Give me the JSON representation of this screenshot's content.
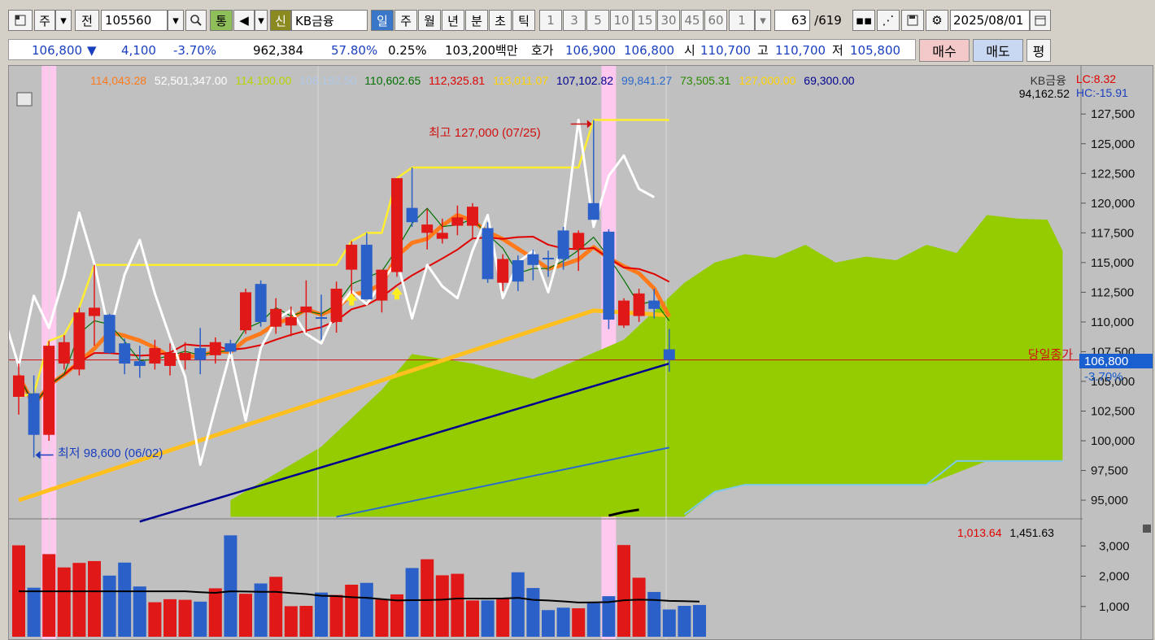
{
  "toolbar": {
    "market": "주",
    "jeon": "전",
    "code": "105560",
    "tong": "통",
    "sin": "신",
    "name": "KB금융",
    "periods": [
      "일",
      "주",
      "월",
      "년",
      "분",
      "초",
      "틱"
    ],
    "active_period": "일",
    "minutes": [
      "1",
      "3",
      "5",
      "10",
      "15",
      "30",
      "45",
      "60"
    ],
    "count_value": "1",
    "page_current": "63",
    "page_total": "/619",
    "date": "2025/08/01"
  },
  "quote": {
    "price": "106,800",
    "change": "4,100",
    "change_pct": "-3.70%",
    "volume": "962,384",
    "ratio": "57.80%",
    "turnover": "0.25%",
    "amount": "103,200백만",
    "hoga_label": "호가",
    "ask": "106,900",
    "bid": "106,800",
    "open_label": "시",
    "open": "110,700",
    "high_label": "고",
    "high": "110,700",
    "low_label": "저",
    "low": "105,800",
    "buy_label": "매수",
    "sell_label": "매도",
    "extra_label": "평"
  },
  "legend": {
    "items": [
      {
        "text": "114,043.28",
        "color": "#ff7a1a"
      },
      {
        "text": "52,501,347.00",
        "color": "#ffffff"
      },
      {
        "text": "114,100.00",
        "color": "#b8d400"
      },
      {
        "text": "108,192.50",
        "color": "#b0c8e8"
      },
      {
        "text": "110,602.65",
        "color": "#007000"
      },
      {
        "text": "112,325.81",
        "color": "#e00000"
      },
      {
        "text": "113,011.07",
        "color": "#ffd400"
      },
      {
        "text": "107,102.82",
        "color": "#000090"
      },
      {
        "text": "99,841.27",
        "color": "#2a6acc"
      },
      {
        "text": "73,505.31",
        "color": "#2a8a00"
      },
      {
        "text": "127,000.00",
        "color": "#ffd400"
      },
      {
        "text": "69,300.00",
        "color": "#000090"
      }
    ],
    "stock": "KB금융",
    "stock_value": "94,162.52",
    "lc": "LC:8.32",
    "hc": "HC:-15.91",
    "vol_items": [
      {
        "text": "1,013.64",
        "color": "#e00000"
      },
      {
        "text": "1,451.63",
        "color": "#000000"
      }
    ]
  },
  "annotations": {
    "high": "최고 127,000 (07/25)",
    "low": "최저 98,600 (06/02)",
    "close_line": "당일종가",
    "close_price": "106,800",
    "close_pct": "-3.70%"
  },
  "colors": {
    "up": "#e01818",
    "down": "#2a60c8",
    "bg": "#c0c0c0"
  },
  "chart_data": {
    "type": "candlestick",
    "price_ticks": [
      "127,500",
      "125,000",
      "122,500",
      "120,000",
      "117,500",
      "115,000",
      "112,500",
      "110,000",
      "107,500",
      "105,000",
      "102,500",
      "100,000",
      "97,500",
      "95,000"
    ],
    "volume_ticks": [
      "3,000",
      "2,000",
      "1,000"
    ],
    "ylim": [
      93500,
      129500
    ],
    "volume_ylim": [
      0,
      3600
    ],
    "candles": [
      {
        "o": 103700,
        "h": 106500,
        "l": 102200,
        "c": 105500
      },
      {
        "o": 104000,
        "h": 105500,
        "l": 98600,
        "c": 100500
      },
      {
        "o": 100500,
        "h": 108400,
        "l": 100000,
        "c": 108000
      },
      {
        "o": 106500,
        "h": 108900,
        "l": 106000,
        "c": 108300
      },
      {
        "o": 106000,
        "h": 111200,
        "l": 105500,
        "c": 110800
      },
      {
        "o": 110500,
        "h": 114800,
        "l": 108000,
        "c": 111200
      },
      {
        "o": 110600,
        "h": 110700,
        "l": 107300,
        "c": 107400
      },
      {
        "o": 108200,
        "h": 108600,
        "l": 105600,
        "c": 106500
      },
      {
        "o": 106700,
        "h": 108000,
        "l": 105300,
        "c": 106300
      },
      {
        "o": 106500,
        "h": 108500,
        "l": 106000,
        "c": 107800
      },
      {
        "o": 106300,
        "h": 108200,
        "l": 105500,
        "c": 107400
      },
      {
        "o": 106800,
        "h": 108300,
        "l": 106000,
        "c": 107400
      },
      {
        "o": 107800,
        "h": 109500,
        "l": 105600,
        "c": 106800
      },
      {
        "o": 107200,
        "h": 108700,
        "l": 106500,
        "c": 108300
      },
      {
        "o": 108200,
        "h": 108500,
        "l": 107300,
        "c": 107500
      },
      {
        "o": 109300,
        "h": 112800,
        "l": 109000,
        "c": 112500
      },
      {
        "o": 113200,
        "h": 113500,
        "l": 109600,
        "c": 110000
      },
      {
        "o": 109600,
        "h": 112000,
        "l": 109000,
        "c": 111100
      },
      {
        "o": 109700,
        "h": 111300,
        "l": 108800,
        "c": 110400
      },
      {
        "o": 110800,
        "h": 113500,
        "l": 109100,
        "c": 111300
      },
      {
        "o": 110400,
        "h": 112300,
        "l": 108500,
        "c": 110300
      },
      {
        "o": 110000,
        "h": 113400,
        "l": 109100,
        "c": 112800
      },
      {
        "o": 114400,
        "h": 116800,
        "l": 112100,
        "c": 116500
      },
      {
        "o": 116500,
        "h": 117500,
        "l": 112000,
        "c": 111900
      },
      {
        "o": 111800,
        "h": 114000,
        "l": 110800,
        "c": 114400
      },
      {
        "o": 114200,
        "h": 122100,
        "l": 113800,
        "c": 122100
      },
      {
        "o": 119600,
        "h": 123000,
        "l": 118000,
        "c": 118400
      },
      {
        "o": 117500,
        "h": 119500,
        "l": 116100,
        "c": 118200
      },
      {
        "o": 117000,
        "h": 118700,
        "l": 116600,
        "c": 117500
      },
      {
        "o": 118100,
        "h": 119800,
        "l": 117300,
        "c": 118800
      },
      {
        "o": 118100,
        "h": 120000,
        "l": 117000,
        "c": 119700
      },
      {
        "o": 117900,
        "h": 118400,
        "l": 113300,
        "c": 113600
      },
      {
        "o": 113300,
        "h": 115700,
        "l": 112600,
        "c": 115300
      },
      {
        "o": 115200,
        "h": 115600,
        "l": 112600,
        "c": 113400
      },
      {
        "o": 115700,
        "h": 116100,
        "l": 113500,
        "c": 114800
      },
      {
        "o": 115400,
        "h": 116000,
        "l": 113800,
        "c": 115300
      },
      {
        "o": 117700,
        "h": 118000,
        "l": 114400,
        "c": 115300
      },
      {
        "o": 116200,
        "h": 117700,
        "l": 114300,
        "c": 117500
      },
      {
        "o": 120000,
        "h": 127000,
        "l": 119200,
        "c": 118600
      },
      {
        "o": 117600,
        "h": 117800,
        "l": 109400,
        "c": 110200
      },
      {
        "o": 109700,
        "h": 112000,
        "l": 109500,
        "c": 111800
      },
      {
        "o": 110500,
        "h": 112800,
        "l": 110000,
        "c": 112400
      },
      {
        "o": 111800,
        "h": 112800,
        "l": 110300,
        "c": 111100
      },
      {
        "o": 107700,
        "h": 109400,
        "l": 105800,
        "c": 106800
      }
    ],
    "volume": [
      3020,
      1620,
      2730,
      2290,
      2440,
      2500,
      2020,
      2450,
      1660,
      1140,
      1240,
      1220,
      1160,
      1600,
      3350,
      1420,
      1760,
      1980,
      1010,
      1020,
      1460,
      1380,
      1720,
      1780,
      1230,
      1400,
      2270,
      2560,
      2030,
      2080,
      1200,
      1200,
      1280,
      2130,
      1610,
      880,
      960,
      940,
      1110,
      1340,
      3030,
      1950,
      1480,
      900,
      1020,
      1050
    ]
  }
}
